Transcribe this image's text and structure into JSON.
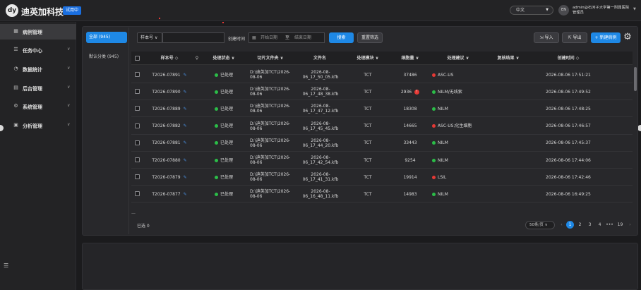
{
  "app": {
    "brand": "迪英加科技",
    "trial_badge": "试用中",
    "logo_text": "dy"
  },
  "header": {
    "language": "中文",
    "avatar_text": "EN",
    "user_line1": "admin@石河子大学第一附属医院",
    "user_line2": "管理员"
  },
  "sidebar": {
    "items": [
      {
        "label": "病例管理",
        "icon": "grid-icon",
        "active": true
      },
      {
        "label": "任务中心",
        "icon": "task-icon"
      },
      {
        "label": "数据统计",
        "icon": "chart-icon"
      },
      {
        "label": "后台管理",
        "icon": "admin-icon"
      },
      {
        "label": "系统管理",
        "icon": "settings-icon"
      },
      {
        "label": "分析管理",
        "icon": "analysis-icon"
      }
    ]
  },
  "categories": {
    "all": "全部 (945)",
    "default": "默认分类 (945)"
  },
  "filters": {
    "search_field": "样本号",
    "search_value": "",
    "created_label": "创建时间",
    "start_placeholder": "开始日期",
    "separator": "至",
    "end_placeholder": "结束日期",
    "search_button": "搜索",
    "reset_button": "重置筛选"
  },
  "toolbar": {
    "import": "导入",
    "export": "导出",
    "new_case": "新建病例"
  },
  "table": {
    "headers": [
      "样本号",
      "处理状态",
      "切片文件夹",
      "文件名",
      "处理模块",
      "细胞量",
      "处理建议",
      "复核结果",
      "创建时间"
    ],
    "rows": [
      {
        "id": "T2026-07891",
        "status": "已处理",
        "folder": "D:\\迪英加TCT\\2026-08-06",
        "file": "2026-08-06_17_50_05.kfb",
        "module": "TCT",
        "cells": "37486",
        "warn": false,
        "advice": "ASC-US",
        "advice_color": "red",
        "review": "",
        "created": "2026-08-06 17:51:21"
      },
      {
        "id": "T2026-07890",
        "status": "已处理",
        "folder": "D:\\迪英加TCT\\2026-08-06",
        "file": "2026-08-06_17_48_38.kfb",
        "module": "TCT",
        "cells": "2936",
        "warn": true,
        "advice": "NILM/无线索",
        "advice_color": "green",
        "review": "",
        "created": "2026-08-06 17:49:52"
      },
      {
        "id": "T2026-07889",
        "status": "已处理",
        "folder": "D:\\迪英加TCT\\2026-08-06",
        "file": "2026-08-06_17_47_12.kfb",
        "module": "TCT",
        "cells": "18308",
        "warn": false,
        "advice": "NILM",
        "advice_color": "green",
        "review": "",
        "created": "2026-08-06 17:48:25"
      },
      {
        "id": "T2026-07882",
        "status": "已处理",
        "folder": "D:\\迪英加TCT\\2026-08-06",
        "file": "2026-08-06_17_45_45.kfb",
        "module": "TCT",
        "cells": "14665",
        "warn": false,
        "advice": "ASC-US;化生细胞",
        "advice_color": "red",
        "review": "",
        "created": "2026-08-06 17:46:57"
      },
      {
        "id": "T2026-07881",
        "status": "已处理",
        "folder": "D:\\迪英加TCT\\2026-08-06",
        "file": "2026-08-06_17_44_20.kfb",
        "module": "TCT",
        "cells": "33443",
        "warn": false,
        "advice": "NILM",
        "advice_color": "green",
        "review": "",
        "created": "2026-08-06 17:45:37"
      },
      {
        "id": "T2026-07880",
        "status": "已处理",
        "folder": "D:\\迪英加TCT\\2026-08-06",
        "file": "2026-08-06_17_42_54.kfb",
        "module": "TCT",
        "cells": "9254",
        "warn": false,
        "advice": "NILM",
        "advice_color": "green",
        "review": "",
        "created": "2026-08-06 17:44:06"
      },
      {
        "id": "T2026-07879",
        "status": "已处理",
        "folder": "D:\\迪英加TCT\\2026-08-06",
        "file": "2026-08-06_17_41_31.kfb",
        "module": "TCT",
        "cells": "19914",
        "warn": false,
        "advice": "LSIL",
        "advice_color": "red",
        "review": "",
        "created": "2026-08-06 17:42:46"
      },
      {
        "id": "T2026-07877",
        "status": "已处理",
        "folder": "D:\\迪英加TCT\\2026-08-06",
        "file": "2026-08-06_16_48_11.kfb",
        "module": "TCT",
        "cells": "14983",
        "warn": false,
        "advice": "NILM",
        "advice_color": "green",
        "review": "",
        "created": "2026-08-06 16:49:25"
      }
    ]
  },
  "footer": {
    "selected": "已选 0",
    "page_size": "50条/页",
    "pages": [
      "1",
      "2",
      "3",
      "4",
      "•••",
      "19"
    ],
    "current_page": "1"
  },
  "colors": {
    "accent": "#1e88e5",
    "ok": "#2bbd48",
    "alert": "#e53935"
  }
}
